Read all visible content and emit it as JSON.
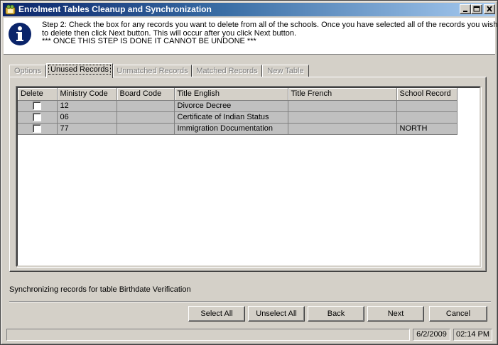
{
  "window": {
    "title": "Enrolment Tables Cleanup and Synchronization",
    "minimize_glyph": "_",
    "maximize_glyph": "□",
    "close_glyph": "×"
  },
  "info": {
    "icon": "information-icon",
    "line1": "Step 2: Check the box for any records you want to delete from all of the schools.  Once you have selected all of the records you wish",
    "line2": "to delete then click Next button. This will occur after you click Next button.",
    "line3": "*** ONCE THIS STEP IS DONE IT CANNOT BE UNDONE ***"
  },
  "tabs": [
    {
      "label": "Options",
      "active": false
    },
    {
      "label": "Unused Records",
      "active": true
    },
    {
      "label": "Unmatched Records",
      "active": false
    },
    {
      "label": "Matched Records",
      "active": false
    },
    {
      "label": "New Table",
      "active": false
    }
  ],
  "grid": {
    "columns": [
      "Delete",
      "Ministry Code",
      "Board Code",
      "Title English",
      "Title French",
      "School Record"
    ],
    "rows": [
      {
        "checked": false,
        "ministry_code": "12",
        "board_code": "",
        "title_english": "Divorce Decree",
        "title_french": "",
        "school_record": ""
      },
      {
        "checked": false,
        "ministry_code": "06",
        "board_code": "",
        "title_english": "Certificate of Indian Status",
        "title_french": "",
        "school_record": ""
      },
      {
        "checked": false,
        "ministry_code": "77",
        "board_code": "",
        "title_english": "Immigration Documentation",
        "title_french": "",
        "school_record": "NORTH"
      }
    ]
  },
  "status_message": "Synchronizing records for table Birthdate Verification",
  "buttons": {
    "select_all": "Select All",
    "unselect_all": "Unselect All",
    "back": "Back",
    "next": "Next",
    "cancel": "Cancel"
  },
  "statusbar": {
    "message": "",
    "date": "6/2/2009",
    "time": "02:14 PM"
  },
  "colors": {
    "titlebar_start": "#0a246a",
    "titlebar_end": "#a6caf0",
    "face": "#d4d0c8",
    "info_icon": "#0a246a"
  }
}
